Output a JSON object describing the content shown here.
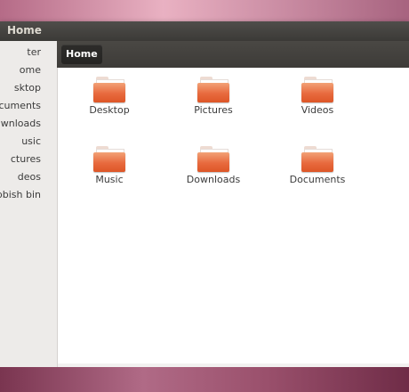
{
  "window": {
    "title": "Home"
  },
  "sidebar": {
    "items": [
      {
        "label": "ter"
      },
      {
        "label": "ome"
      },
      {
        "label": "sktop"
      },
      {
        "label": "ocuments"
      },
      {
        "label": "wnloads"
      },
      {
        "label": "usic"
      },
      {
        "label": "ctures"
      },
      {
        "label": "deos"
      },
      {
        "label": "bbish bin"
      }
    ]
  },
  "toolbar": {
    "breadcrumb": "Home"
  },
  "files": [
    {
      "name": "Desktop",
      "icon": "folder-icon"
    },
    {
      "name": "Pictures",
      "icon": "folder-icon"
    },
    {
      "name": "Videos",
      "icon": "folder-icon"
    },
    {
      "name": "Music",
      "icon": "folder-icon"
    },
    {
      "name": "Downloads",
      "icon": "folder-icon"
    },
    {
      "name": "Documents",
      "icon": "folder-icon"
    }
  ],
  "colors": {
    "folder_accent": "#e8673a",
    "titlebar": "#3c3b37"
  }
}
